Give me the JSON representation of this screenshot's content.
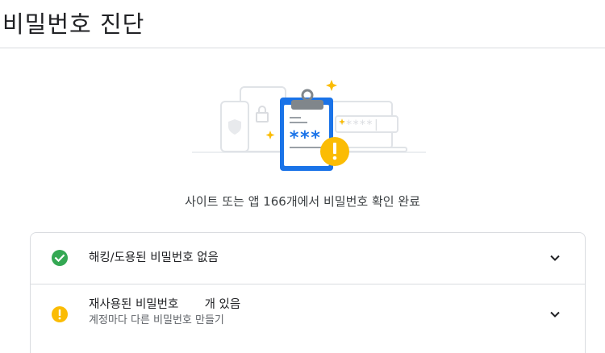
{
  "page": {
    "title": "비밀번호 진단"
  },
  "summary": {
    "text": "사이트 또는 앱 166개에서 비밀번호 확인 완료"
  },
  "illustration": {
    "password_mask": "***",
    "field_mask": "*****|"
  },
  "results": [
    {
      "icon": "check-circle-icon",
      "status_color": "#34a853",
      "title": "해킹/도용된 비밀번호 없음"
    },
    {
      "icon": "warning-circle-icon",
      "status_color": "#fbbc04",
      "title": "재사용된 비밀번호       개 있음",
      "subtitle": "계정마다 다른 비밀번호 만들기"
    }
  ],
  "colors": {
    "accent_blue": "#1a73e8",
    "sparkle_yellow": "#fbbc04",
    "divider": "#dadce0"
  }
}
